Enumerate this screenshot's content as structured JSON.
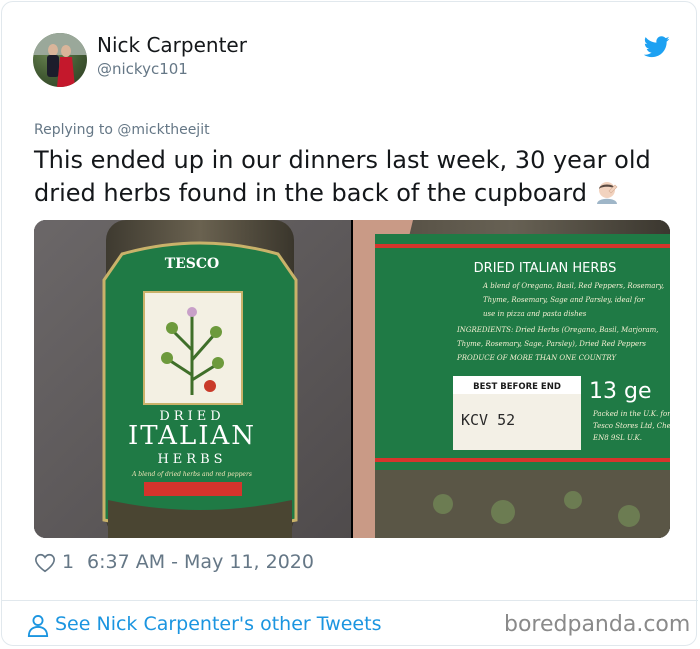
{
  "tweet": {
    "author_name": "Nick Carpenter",
    "author_handle": "@nickyc101",
    "replying_prefix": "Replying to",
    "replying_handle": "@micktheejit",
    "text": "This ended up in our dinners last week, 30 year old dried herbs found in the back of the cupboard",
    "emoji": "man-facepalming-emoji",
    "like_count": "1",
    "timestamp": "6:37 AM - May 11, 2020"
  },
  "photo_left": {
    "brand": "TESCO",
    "word_dried": "DRIED",
    "word_italian": "ITALIAN",
    "word_herbs": "HERBS",
    "tagline": "A blend of dried herbs and red peppers"
  },
  "photo_right": {
    "title": "DRIED ITALIAN HERBS",
    "ingredients_lines": [
      "A blend of Oregano, Basil, Red Peppers, Rosemary,",
      "Thyme, Rosemary, Sage and Parsley, ideal for",
      "use in pizza and pasta dishes",
      "INGREDIENTS: Dried Herbs (Oregano, Basil, Marjoram,",
      "Thyme, Rosemary, Sage, Parsley), Dried Red Peppers",
      "PRODUCE OF MORE THAN ONE COUNTRY"
    ],
    "best_before_label": "BEST BEFORE END",
    "best_before_code": "KCV   52",
    "weight": "13 ge",
    "packed_lines": [
      "Packed in the U.K. for",
      "Tesco Stores Ltd, Cheshunt",
      "EN8 9SL U.K."
    ]
  },
  "footer": {
    "see_more_label": "See Nick Carpenter's other Tweets",
    "watermark": "boredpanda.com"
  },
  "colors": {
    "twitter_blue": "#1da1f2",
    "link_blue": "#1b95e0",
    "label_green": "#1f7a45",
    "label_red": "#d5342c"
  }
}
